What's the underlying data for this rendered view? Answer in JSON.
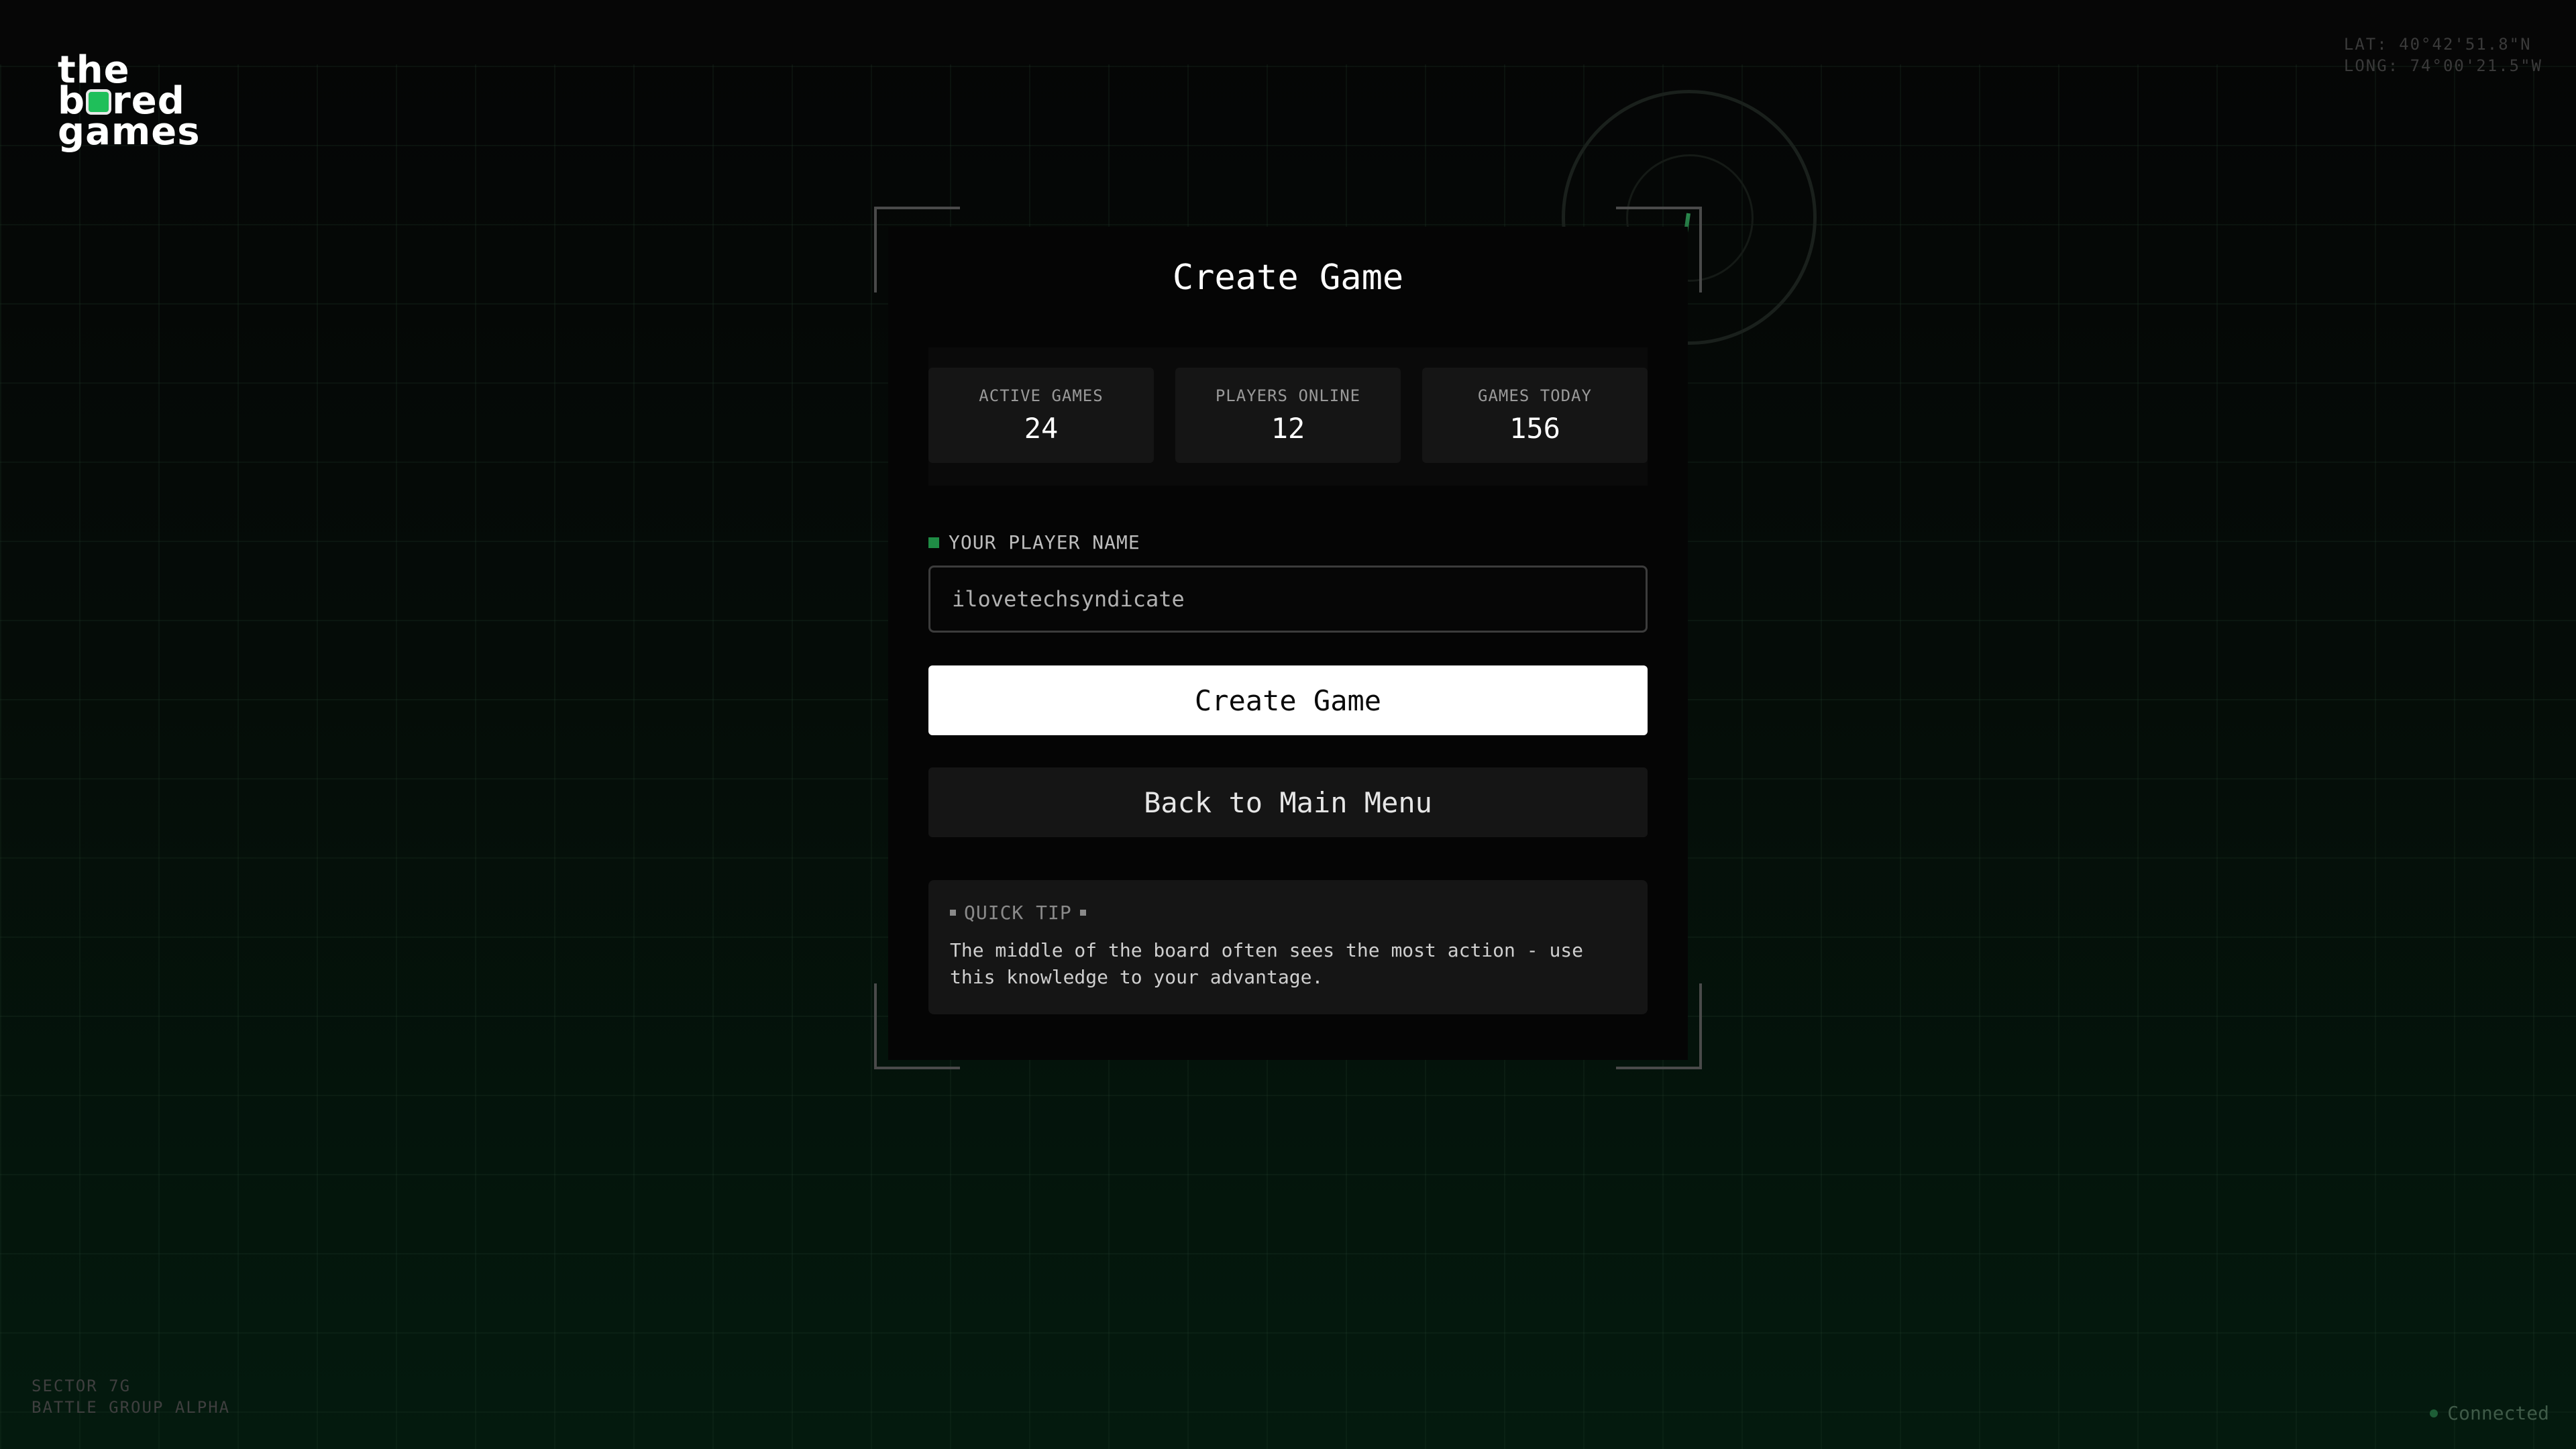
{
  "brand": {
    "logo_line1": "the",
    "logo_line2_a": "b",
    "logo_line2_b": "red",
    "logo_line3": "games",
    "accent_color": "#1fbf5a"
  },
  "location": {
    "lat": "LAT: 40°42'51.8\"N",
    "long": "LONG: 74°00'21.5\"W"
  },
  "footer": {
    "sector": "SECTOR 7G",
    "group": "BATTLE GROUP ALPHA",
    "connection_status": "Connected"
  },
  "page": {
    "title": "Create Game"
  },
  "stats": [
    {
      "label": "ACTIVE GAMES",
      "value": "24"
    },
    {
      "label": "PLAYERS ONLINE",
      "value": "12"
    },
    {
      "label": "GAMES TODAY",
      "value": "156"
    }
  ],
  "form": {
    "player_name_label": "YOUR PLAYER NAME",
    "player_name_value": "ilovetechsyndicate",
    "create_button": "Create Game",
    "back_button": "Back to Main Menu"
  },
  "tip": {
    "heading": "QUICK TIP",
    "text": "The middle of the board often sees the most action - use this knowledge to your advantage."
  },
  "icons": {
    "logo_cube": "dice-icon",
    "radar": "radar-icon",
    "status_dot": "status-dot-icon"
  }
}
